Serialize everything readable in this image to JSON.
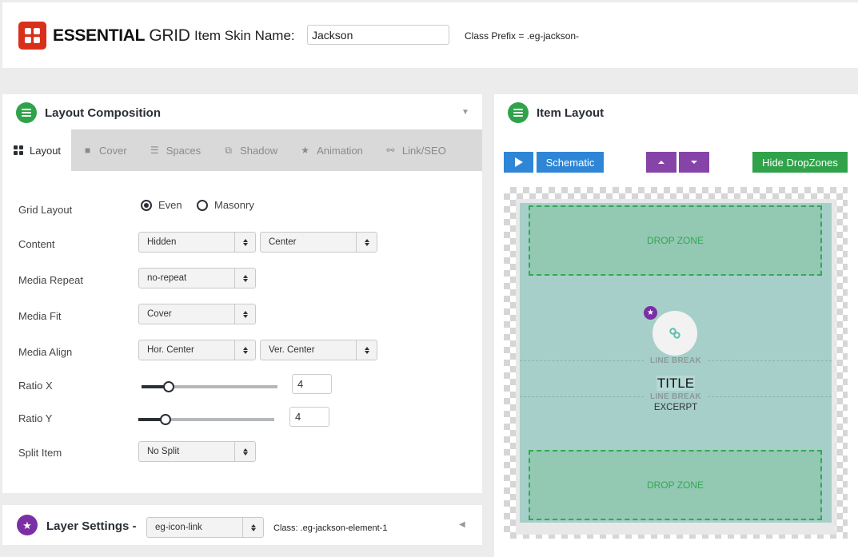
{
  "header": {
    "brand_bold": "ESSENTIAL",
    "brand_light": "GRID",
    "skin_name_label": "Item Skin Name:",
    "skin_name_value": "Jackson",
    "class_prefix": "Class Prefix = .eg-jackson-"
  },
  "layout_composition": {
    "title": "Layout Composition",
    "tabs": [
      {
        "label": "Layout",
        "icon": "grid-icon",
        "active": true
      },
      {
        "label": "Cover",
        "icon": "square-icon",
        "active": false
      },
      {
        "label": "Spaces",
        "icon": "indent-icon",
        "active": false
      },
      {
        "label": "Shadow",
        "icon": "shadow-icon",
        "active": false
      },
      {
        "label": "Animation",
        "icon": "star-icon",
        "active": false
      },
      {
        "label": "Link/SEO",
        "icon": "link-icon",
        "active": false
      }
    ],
    "fields": {
      "grid_layout": {
        "label": "Grid Layout",
        "options": [
          "Even",
          "Masonry"
        ],
        "selected": "Even"
      },
      "content": {
        "label": "Content",
        "value1": "Hidden",
        "value2": "Center"
      },
      "media_repeat": {
        "label": "Media Repeat",
        "value": "no-repeat"
      },
      "media_fit": {
        "label": "Media Fit",
        "value": "Cover"
      },
      "media_align": {
        "label": "Media Align",
        "value1": "Hor. Center",
        "value2": "Ver. Center"
      },
      "ratio_x": {
        "label": "Ratio X",
        "value": "4",
        "slider_fraction": 0.2
      },
      "ratio_y": {
        "label": "Ratio Y",
        "value": "4",
        "slider_fraction": 0.2
      },
      "split_item": {
        "label": "Split Item",
        "value": "No Split"
      }
    }
  },
  "layer_settings": {
    "title": "Layer Settings -",
    "selected_layer": "eg-icon-link",
    "class_label": "Class: .eg-jackson-element-1"
  },
  "item_layout": {
    "title": "Item Layout",
    "schematic_label": "Schematic",
    "hide_dropzones_label": "Hide DropZones",
    "preview": {
      "drop_zone_top": "DROP ZONE",
      "drop_zone_bottom": "DROP ZONE",
      "line_break_1": "LINE BREAK",
      "line_break_2": "LINE BREAK",
      "title": "TITLE",
      "excerpt": "EXCERPT"
    }
  },
  "colors": {
    "brand_red": "#d9301b",
    "accent_green": "#2fa24a",
    "accent_blue": "#2f86d6",
    "accent_purple": "#8644a8",
    "card_bg": "#a6cfca"
  }
}
